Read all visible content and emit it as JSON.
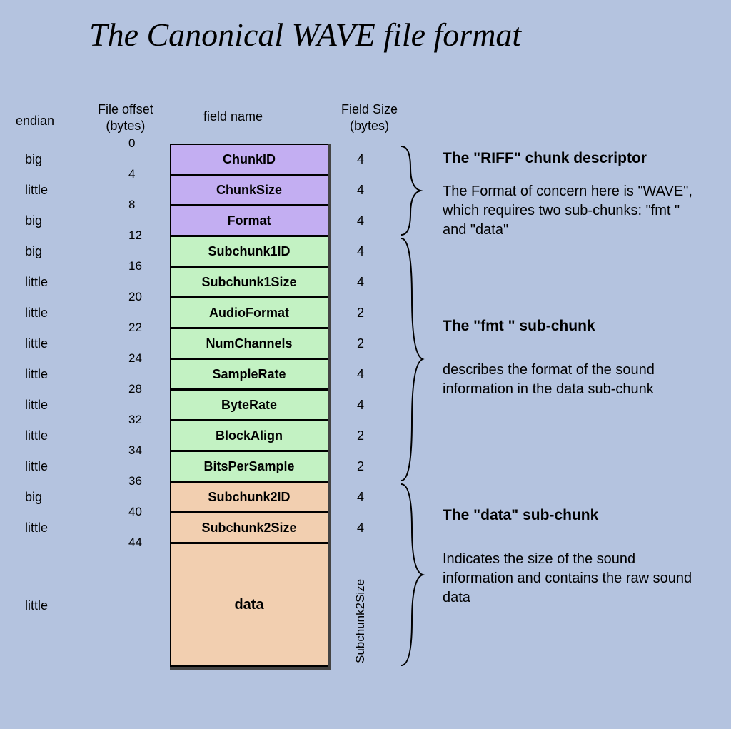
{
  "title": "The Canonical WAVE file format",
  "headers": {
    "endian": "endian",
    "offset": "File offset\n(bytes)",
    "fieldname": "field name",
    "fieldsize": "Field Size\n(bytes)"
  },
  "offsets": [
    "0",
    "4",
    "8",
    "12",
    "16",
    "20",
    "22",
    "24",
    "28",
    "32",
    "34",
    "36",
    "40",
    "44"
  ],
  "rows": [
    {
      "endian": "big",
      "name": "ChunkID",
      "size": "4",
      "group": "riff"
    },
    {
      "endian": "little",
      "name": "ChunkSize",
      "size": "4",
      "group": "riff"
    },
    {
      "endian": "big",
      "name": "Format",
      "size": "4",
      "group": "riff"
    },
    {
      "endian": "big",
      "name": "Subchunk1ID",
      "size": "4",
      "group": "fmt"
    },
    {
      "endian": "little",
      "name": "Subchunk1Size",
      "size": "4",
      "group": "fmt"
    },
    {
      "endian": "little",
      "name": "AudioFormat",
      "size": "2",
      "group": "fmt"
    },
    {
      "endian": "little",
      "name": "NumChannels",
      "size": "2",
      "group": "fmt"
    },
    {
      "endian": "little",
      "name": "SampleRate",
      "size": "4",
      "group": "fmt"
    },
    {
      "endian": "little",
      "name": "ByteRate",
      "size": "4",
      "group": "fmt"
    },
    {
      "endian": "little",
      "name": "BlockAlign",
      "size": "2",
      "group": "fmt"
    },
    {
      "endian": "little",
      "name": "BitsPerSample",
      "size": "2",
      "group": "fmt"
    },
    {
      "endian": "big",
      "name": "Subchunk2ID",
      "size": "4",
      "group": "data"
    },
    {
      "endian": "little",
      "name": "Subchunk2Size",
      "size": "4",
      "group": "data"
    },
    {
      "endian": "little",
      "name": "data",
      "size": "Subchunk2Size",
      "group": "data",
      "tall": true
    }
  ],
  "sections": {
    "riff": {
      "title": "The \"RIFF\" chunk descriptor",
      "desc": "The Format of concern here is \"WAVE\", which requires two sub-chunks: \"fmt \" and \"data\""
    },
    "fmt": {
      "title": "The \"fmt \" sub-chunk",
      "desc": "describes the format of the sound information in the data sub-chunk"
    },
    "data": {
      "title": "The \"data\" sub-chunk",
      "desc": "Indicates the size of the sound information and contains the raw sound data"
    }
  }
}
